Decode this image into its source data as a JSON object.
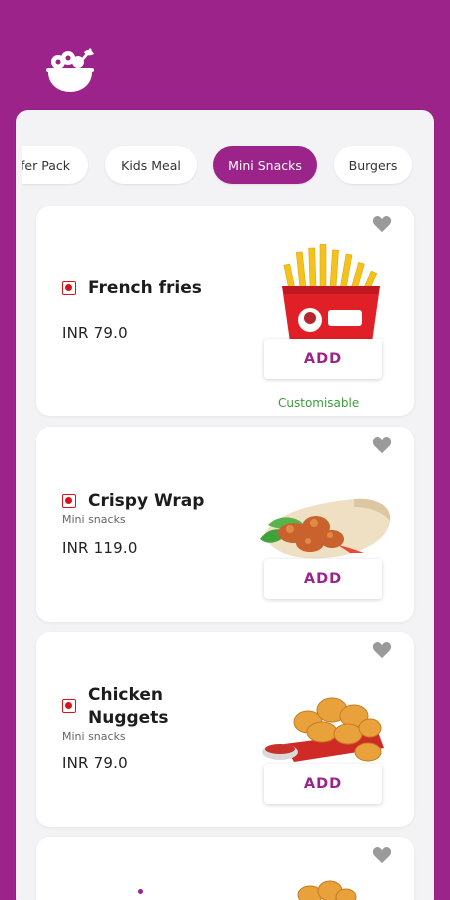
{
  "app": {
    "logo_icon": "salad-bowl-icon"
  },
  "tabs": [
    {
      "label": "fer Pack",
      "active": false
    },
    {
      "label": "Kids Meal",
      "active": false
    },
    {
      "label": "Mini Snacks",
      "active": true
    },
    {
      "label": "Burgers",
      "active": false
    }
  ],
  "items": [
    {
      "name": "French fries",
      "subtitle": "",
      "price": "INR 79.0",
      "add_label": "ADD",
      "note": "Customisable",
      "veg_indicator": "non-veg-icon",
      "image": "french-fries-image"
    },
    {
      "name": "Crispy Wrap",
      "subtitle": "Mini snacks",
      "price": "INR 119.0",
      "add_label": "ADD",
      "note": "",
      "veg_indicator": "non-veg-icon",
      "image": "crispy-wrap-image"
    },
    {
      "name_line1": "Chicken",
      "name_line2": "Nuggets",
      "subtitle": "Mini snacks",
      "price": "INR 79.0",
      "add_label": "ADD",
      "note": "",
      "veg_indicator": "non-veg-icon",
      "image": "chicken-nuggets-image"
    }
  ],
  "colors": {
    "brand": "#9b2389",
    "non_veg": "#d5151e",
    "customisable": "#3a9d3a"
  }
}
